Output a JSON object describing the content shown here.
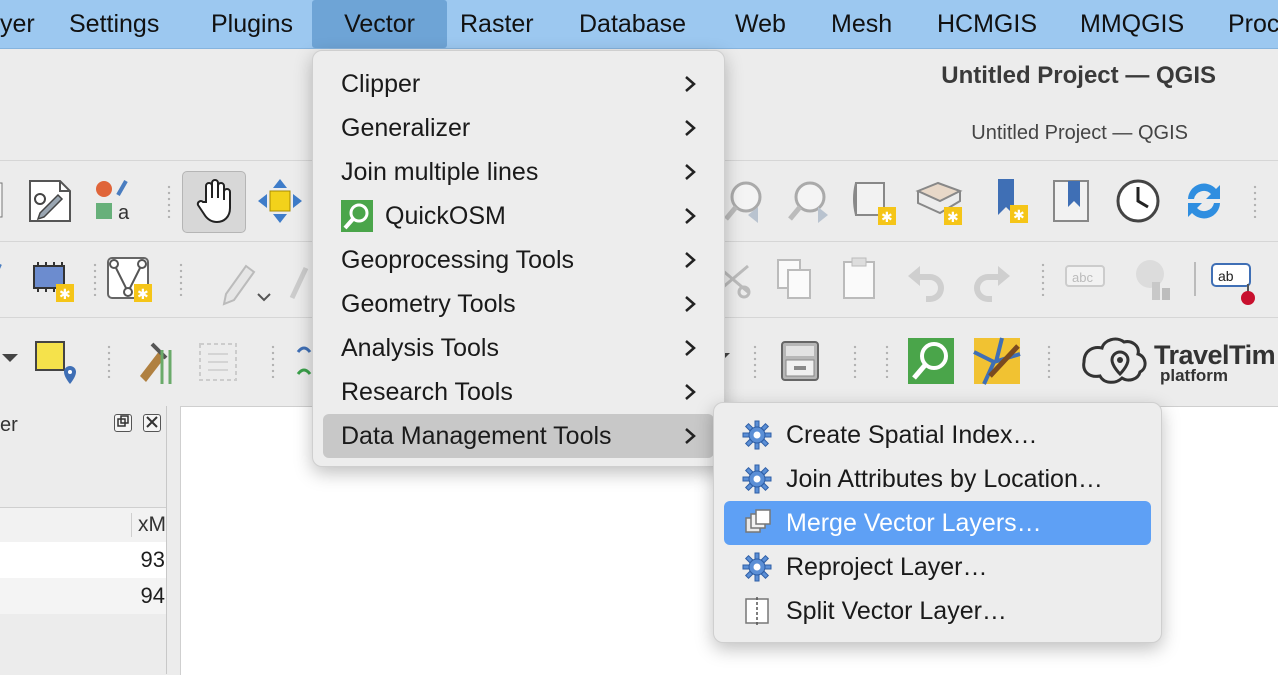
{
  "menubar": {
    "items": [
      "yer",
      "Settings",
      "Plugins",
      "Vector",
      "Raster",
      "Database",
      "Web",
      "Mesh",
      "HCMGIS",
      "MMQGIS",
      "Proc"
    ],
    "active": "Vector"
  },
  "window": {
    "title": "Untitled Project — QGIS",
    "subtitle": "Untitled Project — QGIS"
  },
  "vector_menu": {
    "items": [
      {
        "label": "Clipper",
        "submenu": true
      },
      {
        "label": "Generalizer",
        "submenu": true
      },
      {
        "label": "Join multiple lines",
        "submenu": true
      },
      {
        "label": "QuickOSM",
        "submenu": true,
        "icon": "quickosm-icon"
      },
      {
        "label": "Geoprocessing Tools",
        "submenu": true
      },
      {
        "label": "Geometry Tools",
        "submenu": true
      },
      {
        "label": "Analysis Tools",
        "submenu": true
      },
      {
        "label": "Research Tools",
        "submenu": true
      },
      {
        "label": "Data Management Tools",
        "submenu": true,
        "highlighted": true
      }
    ]
  },
  "data_management_menu": {
    "items": [
      {
        "label": "Create Spatial Index…",
        "icon": "gear-icon"
      },
      {
        "label": "Join Attributes by Location…",
        "icon": "gear-icon"
      },
      {
        "label": "Merge Vector Layers…",
        "icon": "merge-layers-icon",
        "selected": true
      },
      {
        "label": "Reproject Layer…",
        "icon": "gear-icon"
      },
      {
        "label": "Split Vector Layer…",
        "icon": "split-layer-icon"
      }
    ]
  },
  "left_panel": {
    "title": "er",
    "column_header": "xM",
    "rows": [
      "93",
      "94"
    ]
  },
  "plugin_label": {
    "line1": "TravelTim",
    "line2": "platform"
  },
  "colors": {
    "menubar_bg": "#9cc8f0",
    "selected_item": "#5ea0f5",
    "hover_item": "#c8c8c8",
    "menu_bg": "#ededed"
  }
}
